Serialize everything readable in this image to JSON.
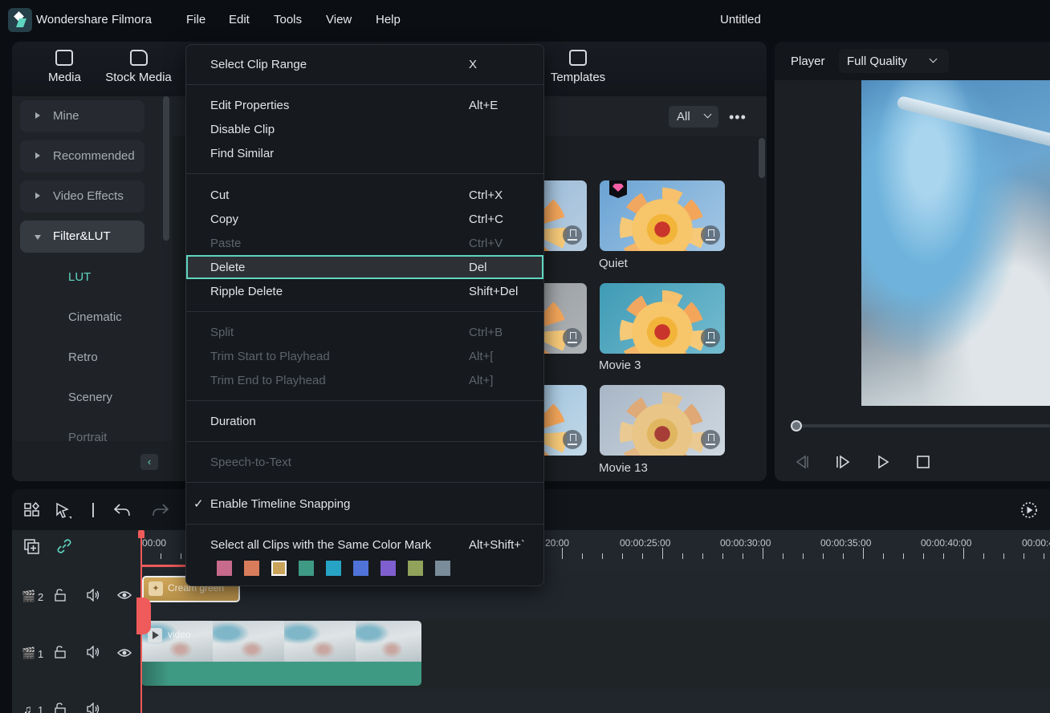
{
  "app": {
    "name": "Wondershare Filmora",
    "doc_title": "Untitled"
  },
  "menubar": [
    "File",
    "Edit",
    "Tools",
    "View",
    "Help"
  ],
  "media_toolbar": {
    "tabs": [
      "Media",
      "Stock Media",
      "Templates"
    ]
  },
  "sidebar": {
    "categories": [
      {
        "label": "Mine",
        "expanded": false
      },
      {
        "label": "Recommended",
        "expanded": false
      },
      {
        "label": "Video Effects",
        "expanded": false
      },
      {
        "label": "Filter&LUT",
        "expanded": true
      }
    ],
    "subcategories": [
      "LUT",
      "Cinematic",
      "Retro",
      "Scenery",
      "Portrait"
    ],
    "active_subcategory": "LUT"
  },
  "content": {
    "filter_dropdown": "All",
    "more_label": "•••",
    "items": [
      {
        "label": "Quiet",
        "premium": true
      },
      {
        "label": "Movie 3",
        "premium": false
      },
      {
        "label": "Movie 13",
        "premium": false
      }
    ]
  },
  "player": {
    "label": "Player",
    "quality": "Full Quality",
    "progress": 0
  },
  "timeline": {
    "timecodes": [
      "00:00",
      "20:00",
      "00:00:25:00",
      "00:00:30:00",
      "00:00:35:00",
      "00:00:40:00",
      "00:00:4"
    ],
    "tracks": [
      {
        "type": "video",
        "number": "2"
      },
      {
        "type": "video",
        "number": "1"
      },
      {
        "type": "audio",
        "number": "1"
      }
    ],
    "clips": {
      "effect": "Cream green",
      "video": "video"
    }
  },
  "context_menu": {
    "groups": [
      [
        {
          "label": "Select Clip Range",
          "shortcut": "X",
          "disabled": false
        }
      ],
      [
        {
          "label": "Edit Properties",
          "shortcut": "Alt+E",
          "disabled": false
        },
        {
          "label": "Disable Clip",
          "shortcut": "",
          "disabled": false
        },
        {
          "label": "Find Similar",
          "shortcut": "",
          "disabled": false
        }
      ],
      [
        {
          "label": "Cut",
          "shortcut": "Ctrl+X",
          "disabled": false
        },
        {
          "label": "Copy",
          "shortcut": "Ctrl+C",
          "disabled": false
        },
        {
          "label": "Paste",
          "shortcut": "Ctrl+V",
          "disabled": true
        },
        {
          "label": "Delete",
          "shortcut": "Del",
          "disabled": false,
          "highlighted": true
        },
        {
          "label": "Ripple Delete",
          "shortcut": "Shift+Del",
          "disabled": false
        }
      ],
      [
        {
          "label": "Split",
          "shortcut": "Ctrl+B",
          "disabled": true
        },
        {
          "label": "Trim Start to Playhead",
          "shortcut": "Alt+[",
          "disabled": true
        },
        {
          "label": "Trim End to Playhead",
          "shortcut": "Alt+]",
          "disabled": true
        }
      ],
      [
        {
          "label": "Duration",
          "shortcut": "",
          "disabled": false
        }
      ],
      [
        {
          "label": "Speech-to-Text",
          "shortcut": "",
          "disabled": true
        }
      ],
      [
        {
          "label": "Enable Timeline Snapping",
          "shortcut": "",
          "disabled": false,
          "checked": true
        }
      ],
      [
        {
          "label": "Select all Clips with the Same Color Mark",
          "shortcut": "Alt+Shift+`",
          "disabled": false
        }
      ]
    ],
    "color_marks": [
      "#c76a8c",
      "#d97c5c",
      "#c9a35a",
      "#3e9a84",
      "#27a3c6",
      "#4f73d9",
      "#7f5fcf",
      "#8fa35a",
      "#7a8b99"
    ],
    "selected_color_index": 2
  },
  "colors": {
    "accent": "#5fd6c0",
    "playhead": "#ef5a5a",
    "clip_audio": "#3f9a84",
    "effect_clip": "#c9a35a"
  }
}
